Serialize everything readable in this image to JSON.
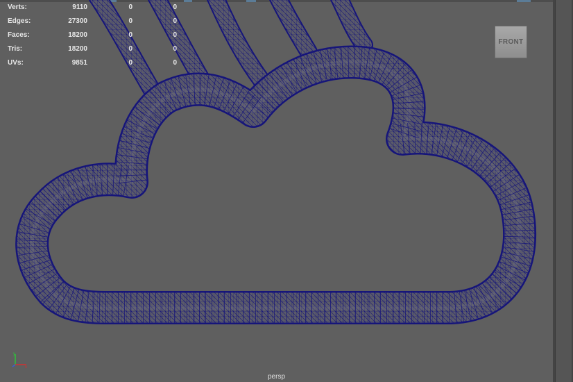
{
  "hud": {
    "rows": [
      {
        "label": "Verts:",
        "v1": "9110",
        "v2": "0",
        "v3": "0"
      },
      {
        "label": "Edges:",
        "v1": "27300",
        "v2": "0",
        "v3": "0"
      },
      {
        "label": "Faces:",
        "v1": "18200",
        "v2": "0",
        "v3": "0"
      },
      {
        "label": "Tris:",
        "v1": "18200",
        "v2": "0",
        "v3": "0"
      },
      {
        "label": "UVs:",
        "v1": "9851",
        "v2": "0",
        "v3": "0"
      }
    ]
  },
  "view_cube": {
    "face_label": "FRONT"
  },
  "camera": {
    "name": "persp"
  },
  "axis_gizmo": {
    "icon": "axis-gizmo-icon",
    "x_color": "#d23030",
    "y_color": "#2fc43a",
    "z_color": "#3a5fd6"
  },
  "colors": {
    "viewport_bg": "#5f5f5f",
    "wireframe": "#16157a",
    "mesh_fill": "#5a5a6a",
    "hud_text": "#e8e8e8"
  }
}
